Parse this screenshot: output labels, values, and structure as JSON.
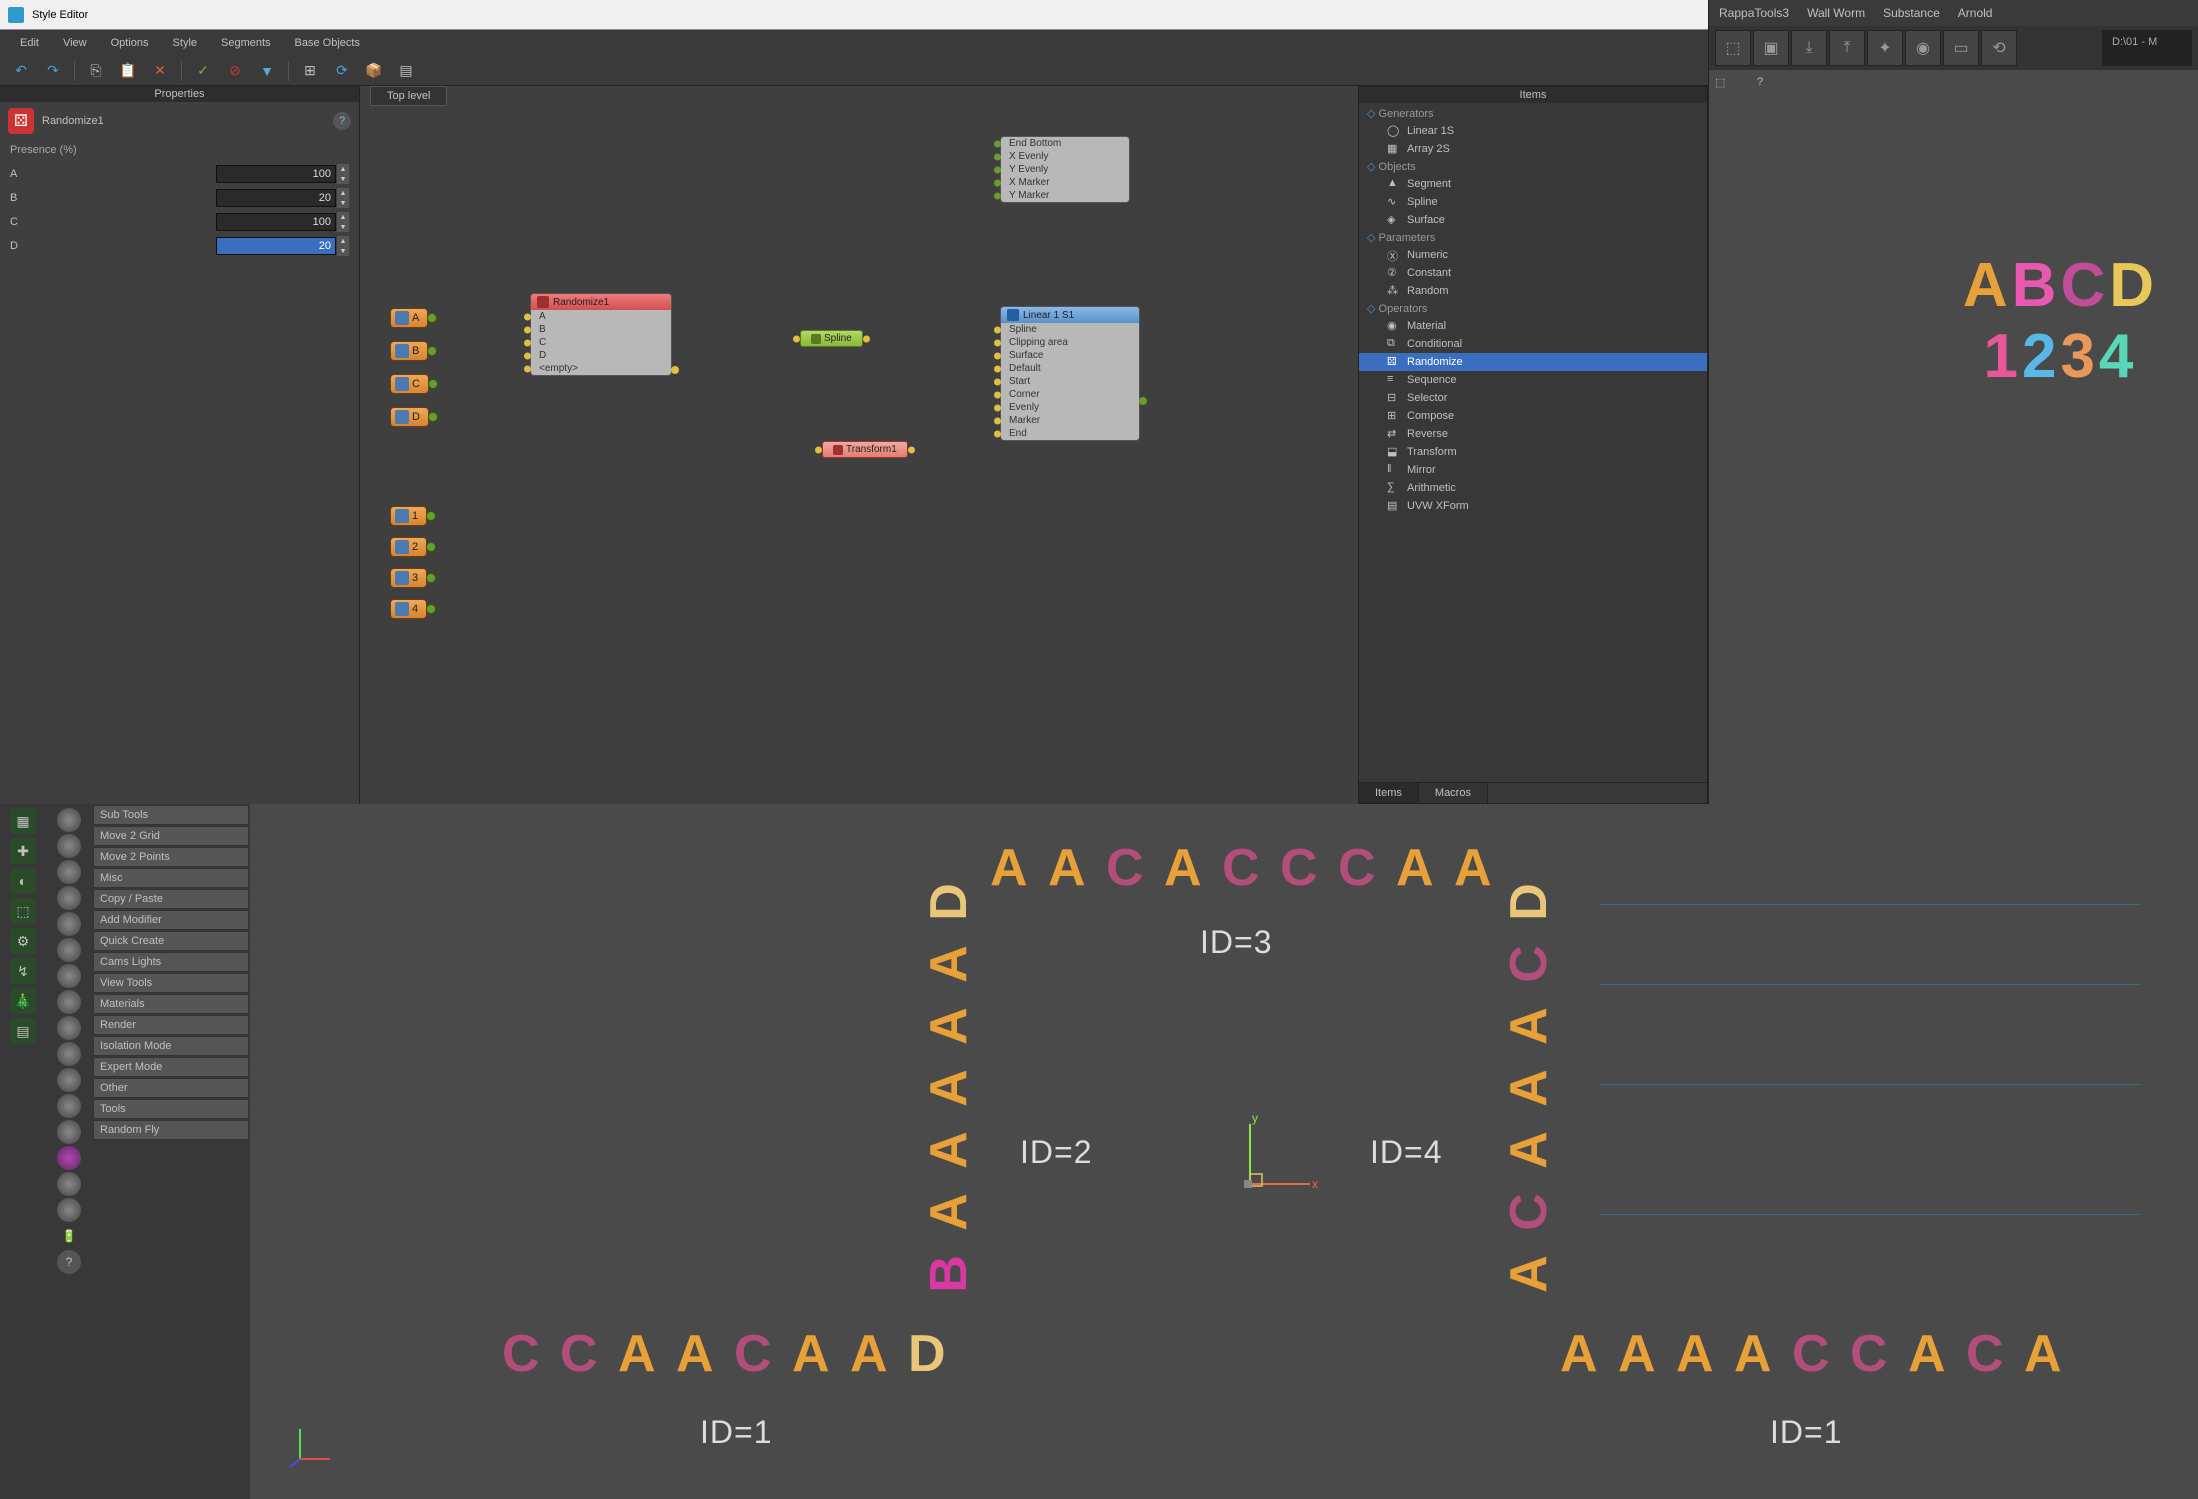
{
  "window": {
    "title": "Style Editor"
  },
  "menu": [
    "Edit",
    "View",
    "Options",
    "Style",
    "Segments",
    "Base Objects"
  ],
  "properties": {
    "panel_title": "Properties",
    "node_name": "Randomize1",
    "section": "Presence (%)",
    "rows": [
      {
        "label": "A",
        "value": "100"
      },
      {
        "label": "B",
        "value": "20"
      },
      {
        "label": "C",
        "value": "100"
      },
      {
        "label": "D",
        "value": "20",
        "selected": true
      }
    ]
  },
  "canvas": {
    "breadcrumb": "Top level",
    "inputs_abcd": [
      "A",
      "B",
      "C",
      "D"
    ],
    "inputs_1234": [
      "1",
      "2",
      "3",
      "4"
    ],
    "randomize": {
      "title": "Randomize1",
      "slots": [
        "A",
        "B",
        "C",
        "D",
        "<empty>"
      ]
    },
    "spline_node": "Spline",
    "transform_node": "Transform1",
    "linear": {
      "title": "Linear 1 S1",
      "slots": [
        "Spline",
        "Clipping area",
        "Surface",
        "Default",
        "Start",
        "Corner",
        "Evenly",
        "Marker",
        "End"
      ]
    },
    "upper": [
      "End Bottom",
      "X Evenly",
      "Y Evenly",
      "X Marker",
      "Y Marker"
    ]
  },
  "items": {
    "panel_title": "Items",
    "categories": [
      {
        "name": "Generators",
        "items": [
          {
            "label": "Linear 1S",
            "icon": "◯"
          },
          {
            "label": "Array 2S",
            "icon": "▦"
          }
        ]
      },
      {
        "name": "Objects",
        "items": [
          {
            "label": "Segment",
            "icon": "▲"
          },
          {
            "label": "Spline",
            "icon": "∿"
          },
          {
            "label": "Surface",
            "icon": "◈"
          }
        ]
      },
      {
        "name": "Parameters",
        "items": [
          {
            "label": "Numeric",
            "icon": "Ⓧ"
          },
          {
            "label": "Constant",
            "icon": "②"
          },
          {
            "label": "Random",
            "icon": "⁂"
          }
        ]
      },
      {
        "name": "Operators",
        "items": [
          {
            "label": "Material",
            "icon": "◉"
          },
          {
            "label": "Conditional",
            "icon": "⧉"
          },
          {
            "label": "Randomize",
            "icon": "⚄",
            "selected": true
          },
          {
            "label": "Sequence",
            "icon": "≡"
          },
          {
            "label": "Selector",
            "icon": "⊟"
          },
          {
            "label": "Compose",
            "icon": "⊞"
          },
          {
            "label": "Reverse",
            "icon": "⇄"
          },
          {
            "label": "Transform",
            "icon": "⬓"
          },
          {
            "label": "Mirror",
            "icon": "‖"
          },
          {
            "label": "Arithmetic",
            "icon": "∑"
          },
          {
            "label": "UVW XForm",
            "icon": "▤"
          }
        ]
      }
    ],
    "tabs": [
      "Items",
      "Macros"
    ]
  },
  "behind": {
    "menus": [
      "RappaTools3",
      "Wall Worm",
      "Substance",
      "Arnold"
    ],
    "path": "D:\\01 - M"
  },
  "leftButtons": [
    "Sub Tools",
    "Move 2 Grid",
    "Move 2 Points",
    "Misc",
    "Copy / Paste",
    "Add Modifier",
    "Quick Create",
    "Cams Lights",
    "View Tools",
    "Materials",
    "Render",
    "Isolation Mode",
    "Expert Mode",
    "Other",
    "Tools",
    "Random Fly"
  ],
  "viewport": {
    "top_row": [
      {
        "t": "A",
        "c": "#e8a038"
      },
      {
        "t": "A",
        "c": "#e8a038"
      },
      {
        "t": "C",
        "c": "#b34d7a"
      },
      {
        "t": "A",
        "c": "#e8a038"
      },
      {
        "t": "C",
        "c": "#b34d7a"
      },
      {
        "t": "C",
        "c": "#b34d7a"
      },
      {
        "t": "C",
        "c": "#b34d7a"
      },
      {
        "t": "A",
        "c": "#e8a038"
      },
      {
        "t": "A",
        "c": "#e8a038"
      }
    ],
    "left_col": [
      {
        "t": "D",
        "c": "#e8c878"
      },
      {
        "t": "A",
        "c": "#e8a038"
      },
      {
        "t": "A",
        "c": "#e8a038"
      },
      {
        "t": "A",
        "c": "#e8a038"
      },
      {
        "t": "A",
        "c": "#e8a038"
      },
      {
        "t": "A",
        "c": "#e8a038"
      },
      {
        "t": "B",
        "c": "#d838a0"
      }
    ],
    "right_col": [
      {
        "t": "D",
        "c": "#e8c878"
      },
      {
        "t": "C",
        "c": "#b34d7a"
      },
      {
        "t": "A",
        "c": "#e8a038"
      },
      {
        "t": "A",
        "c": "#e8a038"
      },
      {
        "t": "A",
        "c": "#e8a038"
      },
      {
        "t": "C",
        "c": "#b34d7a"
      },
      {
        "t": "A",
        "c": "#e8a038"
      }
    ],
    "bottom_left": [
      {
        "t": "C",
        "c": "#b34d7a"
      },
      {
        "t": "C",
        "c": "#b34d7a"
      },
      {
        "t": "A",
        "c": "#e8a038"
      },
      {
        "t": "A",
        "c": "#e8a038"
      },
      {
        "t": "C",
        "c": "#b34d7a"
      },
      {
        "t": "A",
        "c": "#e8a038"
      },
      {
        "t": "A",
        "c": "#e8a038"
      },
      {
        "t": "D",
        "c": "#e8c878"
      }
    ],
    "bottom_right": [
      {
        "t": "A",
        "c": "#e8a038"
      },
      {
        "t": "A",
        "c": "#e8a038"
      },
      {
        "t": "A",
        "c": "#e8a038"
      },
      {
        "t": "A",
        "c": "#e8a038"
      },
      {
        "t": "C",
        "c": "#b34d7a"
      },
      {
        "t": "C",
        "c": "#b34d7a"
      },
      {
        "t": "A",
        "c": "#e8a038"
      },
      {
        "t": "C",
        "c": "#b34d7a"
      },
      {
        "t": "A",
        "c": "#e8a038"
      }
    ],
    "labels": {
      "id1a": "ID=1",
      "id1b": "ID=1",
      "id2": "ID=2",
      "id3": "ID=3",
      "id4": "ID=4"
    }
  },
  "preview": {
    "abcd": [
      {
        "t": "A",
        "c": "#e8a038"
      },
      {
        "t": "B",
        "c": "#e858b0"
      },
      {
        "t": "C",
        "c": "#c04d98"
      },
      {
        "t": "D",
        "c": "#e8c858"
      }
    ],
    "nums": [
      {
        "t": "1",
        "c": "#e85898"
      },
      {
        "t": "2",
        "c": "#58b8e8"
      },
      {
        "t": "3",
        "c": "#e89858"
      },
      {
        "t": "4",
        "c": "#58d8b8"
      }
    ]
  }
}
